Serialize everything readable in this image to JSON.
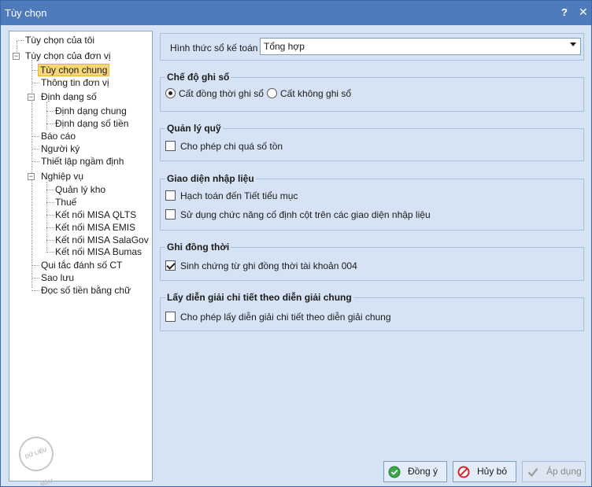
{
  "window": {
    "title": "Tùy chọn",
    "help_label": "?",
    "close_label": "✕"
  },
  "tree": {
    "nodes": [
      {
        "label": "Tùy chọn của tôi"
      },
      {
        "label": "Tùy chọn của đơn vị",
        "expander": "⊟"
      },
      {
        "label": "Tùy chọn chung",
        "selected": true
      },
      {
        "label": "Thông tin đơn vị"
      },
      {
        "label": "Định dạng số",
        "expander": "⊟"
      },
      {
        "label": "Định dạng chung"
      },
      {
        "label": "Định dạng số tiền"
      },
      {
        "label": "Báo cáo"
      },
      {
        "label": "Người ký"
      },
      {
        "label": "Thiết lập ngầm định"
      },
      {
        "label": "Nghiệp vụ",
        "expander": "⊟"
      },
      {
        "label": "Quản lý kho"
      },
      {
        "label": "Thuế"
      },
      {
        "label": "Kết nối MISA QLTS"
      },
      {
        "label": "Kết nối MISA EMIS"
      },
      {
        "label": "Kết nối MISA SalaGov"
      },
      {
        "label": "Kết nối MISA Bumas"
      },
      {
        "label": "Qui tắc đánh số CT"
      },
      {
        "label": "Sao lưu"
      },
      {
        "label": "Đọc số tiền bằng chữ"
      }
    ],
    "stamp_text": "DỮ LIỆU MẪU"
  },
  "accounting_form": {
    "label": "Hình thức sổ kế toán",
    "value": "Tổng hợp"
  },
  "groups": {
    "posting_mode": {
      "title": "Chế độ ghi sổ",
      "options": [
        {
          "label": "Cất đồng thời ghi sổ",
          "checked": true
        },
        {
          "label": "Cất không ghi sổ",
          "checked": false
        }
      ]
    },
    "fund_management": {
      "title": "Quản lý quỹ",
      "options": [
        {
          "label": "Cho phép chi quá số tồn",
          "checked": false
        }
      ]
    },
    "input_interface": {
      "title": "Giao diện nhập liệu",
      "options": [
        {
          "label": "Hạch toán đến Tiết tiểu mục",
          "checked": false
        },
        {
          "label": "Sử dụng chức năng cố định cột trên các giao diện nhập liệu",
          "checked": false
        }
      ]
    },
    "simultaneous_posting": {
      "title": "Ghi đồng thời",
      "options": [
        {
          "label": "Sinh chứng từ ghi đồng thời tài khoản 004",
          "checked": true
        }
      ]
    },
    "detail_description": {
      "title": "Lấy diễn giải chi tiết theo diễn giải chung",
      "options": [
        {
          "label": "Cho phép lấy diễn giải chi tiết theo diễn giải chung",
          "checked": false
        }
      ]
    }
  },
  "buttons": {
    "ok": "Đồng ý",
    "cancel": "Hủy bỏ",
    "apply": "Áp dụng"
  },
  "colors": {
    "title_bar": "#4f7bbd",
    "panel": "#d6e3f4",
    "selection": "#f6d67c"
  }
}
